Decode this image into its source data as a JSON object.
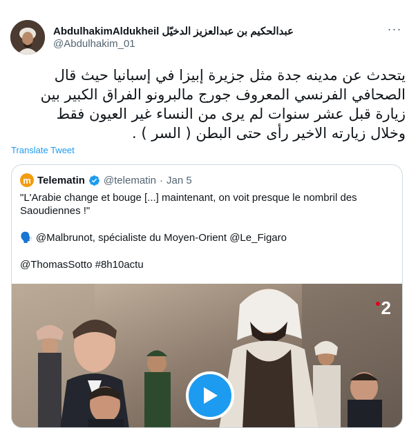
{
  "tweet": {
    "display_name": "AbdulhakimAldukheil عبدالحكيم بن عبدالعزيز الدخيّل",
    "handle": "@Abdulhakim_01",
    "more_label": "···",
    "text_lines": [
      "يتحدث عن مدينه جدة مثل جزيرة إبيزا في إسبانيا حيث قال",
      "الصحافي الفرنسي المعروف جورج مالبرونو الفراق الكبير بين",
      "زيارة قبل عشر سنوات لم يرى من النساء غير العيون فقط",
      "وخلال زيارته الاخير رأى حتى البطن ( السر ) ."
    ],
    "translate_label": "Translate Tweet"
  },
  "quote": {
    "logo_letter": "m",
    "name": "Telematin",
    "handle": "@telematin",
    "separator": "·",
    "date": "Jan 5",
    "line1": "\"L'Arabie change et bouge [...] maintenant, on voit presque le nombril des Saoudiennes !\"",
    "speaker_emoji": "🗣️",
    "line2": "@Malbrunot, spécialiste du Moyen-Orient @Le_Figaro",
    "line3": "@ThomasSotto #8h10actu",
    "channel_badge": "2"
  },
  "colors": {
    "accent": "#1d9bf0",
    "text": "#0f1419",
    "muted": "#536471",
    "border": "#cfd9de"
  }
}
